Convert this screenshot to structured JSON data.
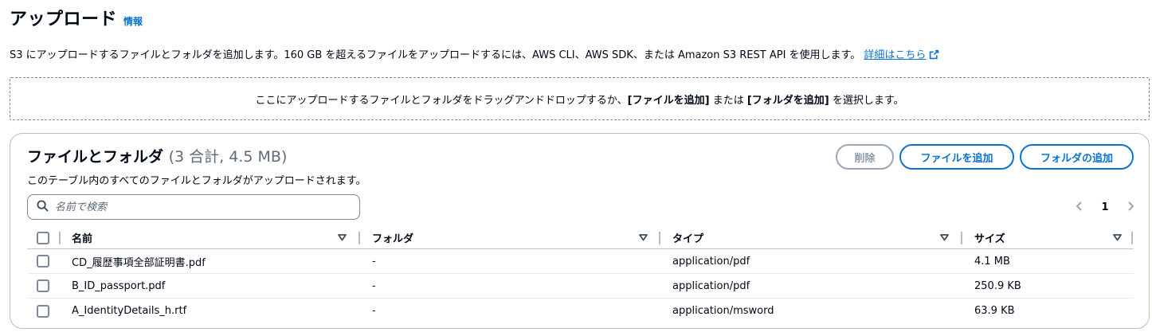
{
  "header": {
    "title": "アップロード",
    "info_label": "情報"
  },
  "description": {
    "text": "S3 にアップロードするファイルとフォルダを追加します。160 GB を超えるファイルをアップロードするには、AWS CLI、AWS SDK、または Amazon S3 REST API を使用します。",
    "link_label": "詳細はこちら"
  },
  "dropzone": {
    "prefix": "ここにアップロードするファイルとフォルダをドラッグアンドドロップするか、",
    "add_files": "[ファイルを追加]",
    "middle": " または ",
    "add_folder": "[フォルダを追加]",
    "suffix": " を選択します。"
  },
  "panel": {
    "title": "ファイルとフォルダ",
    "count": "(3 合計, 4.5 MB)",
    "subtitle": "このテーブル内のすべてのファイルとフォルダがアップロードされます。",
    "buttons": {
      "delete": "削除",
      "add_files": "ファイルを追加",
      "add_folder": "フォルダの追加"
    },
    "search": {
      "placeholder": "名前で検索",
      "value": ""
    },
    "pagination": {
      "current_page": "1"
    }
  },
  "table": {
    "columns": [
      "名前",
      "フォルダ",
      "タイプ",
      "サイズ"
    ],
    "rows": [
      {
        "name": "CD_履歴事項全部証明書.pdf",
        "folder": "-",
        "type": "application/pdf",
        "size": "4.1 MB"
      },
      {
        "name": "B_ID_passport.pdf",
        "folder": "-",
        "type": "application/pdf",
        "size": "250.9 KB"
      },
      {
        "name": "A_IdentityDetails_h.rtf",
        "folder": "-",
        "type": "application/msword",
        "size": "63.9 KB"
      }
    ]
  },
  "colors": {
    "accent": "#0972d3",
    "text": "#000716",
    "muted": "#5f6b7a",
    "border": "#b6bec9",
    "disabled": "#8d99a8"
  }
}
